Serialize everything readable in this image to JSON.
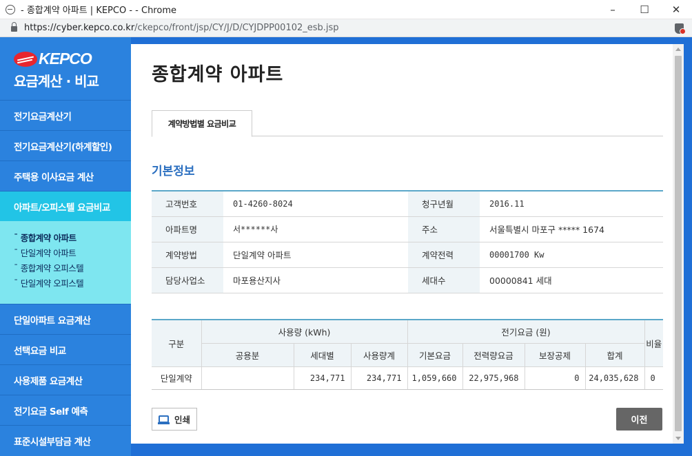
{
  "window": {
    "title": "- 종합계약 아파트 | KEPCO - - Chrome",
    "minimize_label": "–",
    "maximize_label": "☐",
    "close_label": "✕"
  },
  "address": {
    "host": "https://cyber.kepco.co.kr",
    "path": "/ckepco/front/jsp/CY/J/D/CYJDPP00102_esb.jsp"
  },
  "sidebar": {
    "brand": "KEPCO",
    "subtitle": "요금계산 · 비교",
    "items_top": [
      {
        "label": "전기요금계산기"
      },
      {
        "label": "전기요금계산기(하계할인)"
      },
      {
        "label": "주택용 이사요금 계산"
      },
      {
        "label": "아파트/오피스텔 요금비교"
      }
    ],
    "subitems": [
      {
        "label": "종합계약 아파트"
      },
      {
        "label": "단일계약 아파트"
      },
      {
        "label": "종합계약 오피스텔"
      },
      {
        "label": "단일계약 오피스텔"
      }
    ],
    "subitem_dash": "ˉ",
    "items_bottom": [
      {
        "label": "단일아파트 요금계산"
      },
      {
        "label": "선택요금 비교"
      },
      {
        "label": "사용제품 요금계산"
      },
      {
        "label": "전기요금 Self 예측"
      },
      {
        "label": "표준시설부담금 계산"
      }
    ]
  },
  "main": {
    "title": "종합계약 아파트",
    "tab_label": "계약방법별 요금비교",
    "section_title": "기본정보",
    "info": {
      "customer_no_label": "고객번호",
      "customer_no": "01-4260-8024",
      "billing_month_label": "청구년월",
      "billing_month": "2016.11",
      "apt_name_label": "아파트명",
      "apt_name": "서******사",
      "address_label": "주소",
      "address": "서울특별시 마포구 ***** 1674",
      "contract_method_label": "계약방법",
      "contract_method": "단일계약 아파트",
      "contract_power_label": "계약전력",
      "contract_power": "00001700 Kw",
      "office_label": "담당사업소",
      "office": "마포용산지사",
      "households_label": "세대수",
      "households": "00000841 세대"
    },
    "fee_table": {
      "h_category": "구분",
      "h_usage": "사용량 (kWh)",
      "h_fee": "전기요금 (원)",
      "h_ratio": "비율",
      "h_common": "공용분",
      "h_household": "세대별",
      "h_usage_total": "사용량계",
      "h_basic": "기본요금",
      "h_energy": "전력량요금",
      "h_guarantee": "보장공제",
      "h_total": "합계",
      "row": {
        "category": "단일계약",
        "common": "",
        "household": "234,771",
        "usage_total": "234,771",
        "basic": "1,059,660",
        "energy": "22,975,968",
        "guarantee": "0",
        "total": "24,035,628",
        "ratio": "0"
      }
    },
    "print_label": "인쇄",
    "prev_label": "이전"
  }
}
